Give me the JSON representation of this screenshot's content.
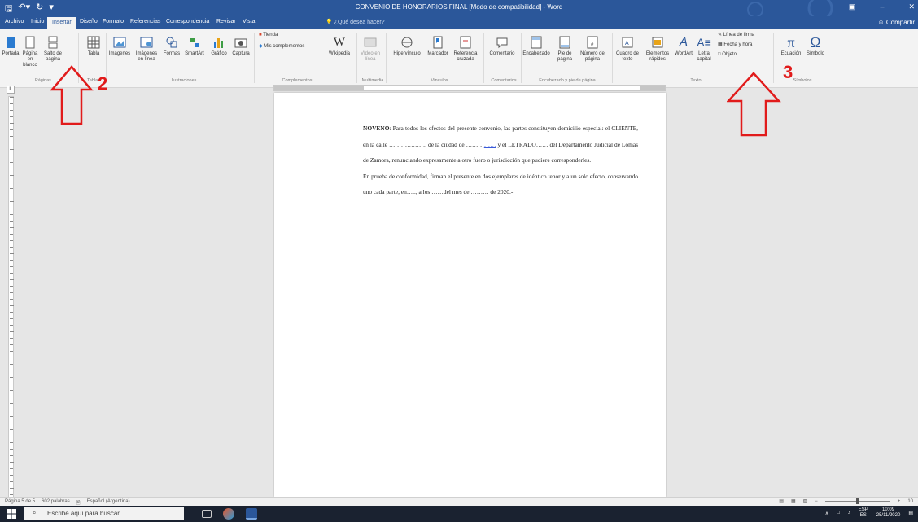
{
  "titlebar": {
    "title": "CONVENIO DE HONORARIOS FINAL [Modo de compatibilidad] - Word",
    "qat": [
      "save-icon",
      "undo-icon",
      "customize-icon"
    ],
    "controls": [
      "ribbon-display-icon",
      "minimize-icon",
      "close-icon"
    ]
  },
  "tabs": [
    {
      "label": "Archivo"
    },
    {
      "label": "Inicio"
    },
    {
      "label": "Insertar",
      "active": true
    },
    {
      "label": "Diseño"
    },
    {
      "label": "Formato"
    },
    {
      "label": "Referencias"
    },
    {
      "label": "Correspondencia"
    },
    {
      "label": "Revisar"
    },
    {
      "label": "Vista"
    }
  ],
  "tell_me": "¿Qué desea hacer?",
  "share": "Compartir",
  "ribbon": {
    "buttons": [
      {
        "label": "Portada"
      },
      {
        "label": "Página en blanco"
      },
      {
        "label": "Salto de página"
      },
      {
        "label": "Tabla"
      },
      {
        "label": "Imágenes"
      },
      {
        "label": "Imágenes en línea"
      },
      {
        "label": "Formas"
      },
      {
        "label": "SmartArt"
      },
      {
        "label": "Gráfico"
      },
      {
        "label": "Captura"
      },
      {
        "label": "Tienda"
      },
      {
        "label": "Mis complementos"
      },
      {
        "label": "Wikipedia"
      },
      {
        "label": "Vídeo en línea"
      },
      {
        "label": "Hipervínculo"
      },
      {
        "label": "Marcador"
      },
      {
        "label": "Referencia cruzada"
      },
      {
        "label": "Comentario"
      },
      {
        "label": "Encabezado"
      },
      {
        "label": "Pie de página"
      },
      {
        "label": "Número de página"
      },
      {
        "label": "Cuadro de texto"
      },
      {
        "label": "Elementos rápidos"
      },
      {
        "label": "WordArt"
      },
      {
        "label": "Letra capital"
      },
      {
        "label": "Línea de firma"
      },
      {
        "label": "Fecha y hora"
      },
      {
        "label": "Objeto"
      },
      {
        "label": "Ecuación"
      },
      {
        "label": "Símbolo"
      }
    ],
    "groups": [
      "Páginas",
      "Tablas",
      "Ilustraciones",
      "Complementos",
      "Multimedia",
      "Vínculos",
      "Comentarios",
      "Encabezado y pie de página",
      "Texto",
      "Símbolos"
    ]
  },
  "document": {
    "p1_bold": "NOVENO",
    "p1": ": Para todos los efectos del presente convenio, las partes constituyen domicilio especial: el CLIENTE, en la calle ………………, de la ciudad de ………",
    "p1_link": "……",
    "p1_tail": " y el LETRADO…… del Departamento Judicial de Lomas de Zamora, renunciando expresamente a otro fuero o jurisdicción que pudiere corresponderles.",
    "p2": "En prueba de conformidad, firman el presente en dos ejemplares de idéntico tenor y a un solo efecto, conservando uno cada parte, en….., a los ……del mes de ……… de 2020.-"
  },
  "status": {
    "page": "Página 5 de 5",
    "words": "602 palabras",
    "language": "Español (Argentina)",
    "zoom": "10"
  },
  "taskbar": {
    "search_placeholder": "Escribe aquí para buscar",
    "lang": "ESP",
    "lang2": "ES",
    "time": "10:09",
    "date": "25/11/2020"
  },
  "annotations": {
    "label_2": "2",
    "label_3": "3"
  }
}
